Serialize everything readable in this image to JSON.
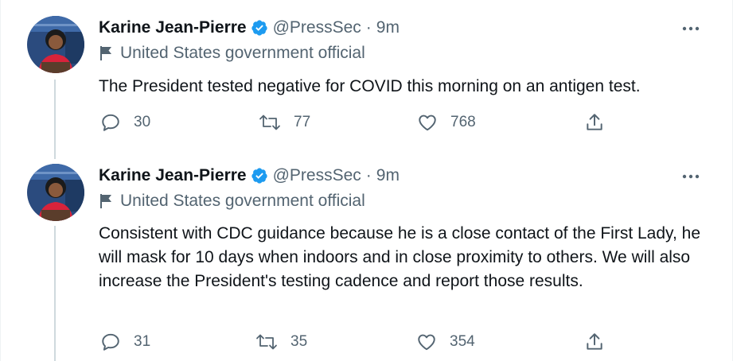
{
  "tweets": [
    {
      "author_name": "Karine Jean-Pierre",
      "handle": "@PressSec",
      "separator": "·",
      "time": "9m",
      "label": "United States government official",
      "text": "The President tested negative for COVID this morning on an antigen test.",
      "replies": "30",
      "retweets": "77",
      "likes": "768"
    },
    {
      "author_name": "Karine Jean-Pierre",
      "handle": "@PressSec",
      "separator": "·",
      "time": "9m",
      "label": "United States government official",
      "text": "Consistent with CDC guidance because he is a close contact of the First Lady, he will mask for 10 days when indoors and in close proximity to others. We will also increase the President's testing cadence and report those results.",
      "replies": "31",
      "retweets": "35",
      "likes": "354"
    }
  ],
  "colors": {
    "verified": "#1d9bf0",
    "text_primary": "#0f1419",
    "text_secondary": "#536471",
    "thread_line": "#cfd9de"
  },
  "icons": [
    "verified-badge-icon",
    "flag-icon",
    "more-icon",
    "reply-icon",
    "retweet-icon",
    "like-icon",
    "share-icon"
  ]
}
